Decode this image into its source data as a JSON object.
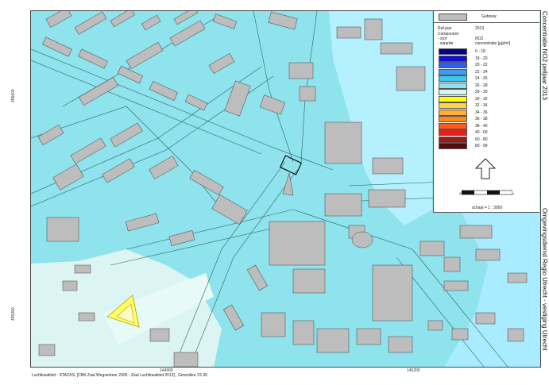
{
  "map": {
    "title": "Concentratie NO2 peiljaar 2013",
    "organisation": "Omgevingsdienst Regio Utrecht - vestiging Utrecht",
    "footer": "Luchtkwaliteit - STACKS, [CBK Zaal Wegverkeer 2005 - Zaal Luchtkwaliteit 2013] , Geomilieu V2.35",
    "coords": {
      "y1": "455600",
      "y2": "455200",
      "x1": "144900",
      "x2": "145200"
    },
    "colors": {
      "background": "#8fe3ec",
      "building": "#bdbdbd",
      "building_stroke": "#444444",
      "road_outline": "#2f5f66",
      "light_zone": "#dcf5f2",
      "high_zone": "#b5f0ff",
      "yellow_zone": "#ffff66"
    }
  },
  "legend": {
    "building_label": "Gebouw",
    "meta": {
      "ref_year_label": "Ref.jaar",
      "ref_year_value": "2013",
      "component_label": "Component:",
      "emission_label": "- stof",
      "emission_value": "NO2",
      "value_label": "- waarde",
      "value_value": "concentratie [µg/m³]"
    },
    "classes": [
      {
        "label": "0 - 18",
        "color": "#00008b"
      },
      {
        "label": "18 - 20",
        "color": "#1010d8"
      },
      {
        "label": "20 - 22",
        "color": "#2e5ef0"
      },
      {
        "label": "22 - 24",
        "color": "#3d9cf5"
      },
      {
        "label": "24 - 26",
        "color": "#3dc7f0"
      },
      {
        "label": "26 - 28",
        "color": "#8fe3ec"
      },
      {
        "label": "28 - 30",
        "color": "#d4f7f2"
      },
      {
        "label": "30 - 32",
        "color": "#ffff00"
      },
      {
        "label": "32 - 34",
        "color": "#ffd34d"
      },
      {
        "label": "34 - 36",
        "color": "#ffb03b"
      },
      {
        "label": "36 - 38",
        "color": "#ff8c1a"
      },
      {
        "label": "38 - 40",
        "color": "#ff5a1a"
      },
      {
        "label": "40 - 60",
        "color": "#e61e1e"
      },
      {
        "label": "60 - 80",
        "color": "#a01818"
      },
      {
        "label": "80 - 99",
        "color": "#5a0a0a"
      }
    ],
    "scale_zero": "0m",
    "scale_hundred": "100 m",
    "scale_text": "schaal = 1 : 3000"
  }
}
